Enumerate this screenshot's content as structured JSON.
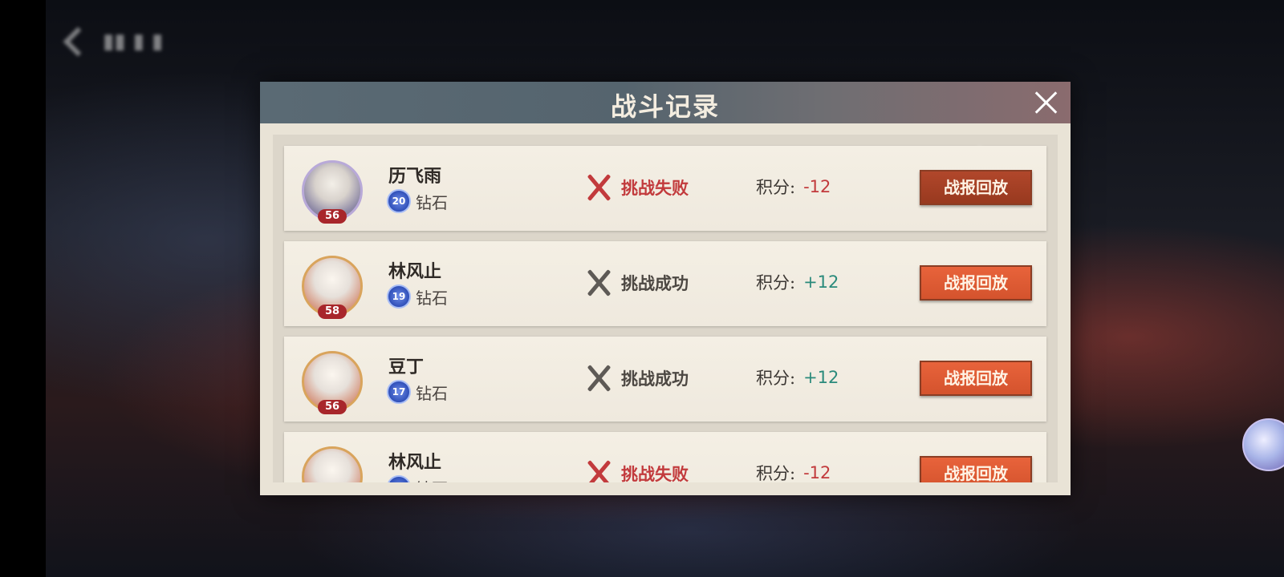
{
  "modal": {
    "title": "战斗记录",
    "score_label": "积分:"
  },
  "records": [
    {
      "name": "历飞雨",
      "level": "56",
      "rank_stars": "20",
      "rank": "钻石",
      "result": "挑战失败",
      "score": "-12",
      "replay_label": "战报回放"
    },
    {
      "name": "林风止",
      "level": "58",
      "rank_stars": "19",
      "rank": "钻石",
      "result": "挑战成功",
      "score": "+12",
      "replay_label": "战报回放"
    },
    {
      "name": "豆丁",
      "level": "56",
      "rank_stars": "17",
      "rank": "钻石",
      "result": "挑战成功",
      "score": "+12",
      "replay_label": "战报回放"
    },
    {
      "name": "林风止",
      "level": "",
      "rank_stars": "",
      "rank": "钻石",
      "result": "挑战失败",
      "score": "-12",
      "replay_label": "战报回放"
    }
  ],
  "colors": {
    "fail": "#c23a3c",
    "success_score": "#2a8a7b",
    "replay_button": "#d4532d"
  }
}
